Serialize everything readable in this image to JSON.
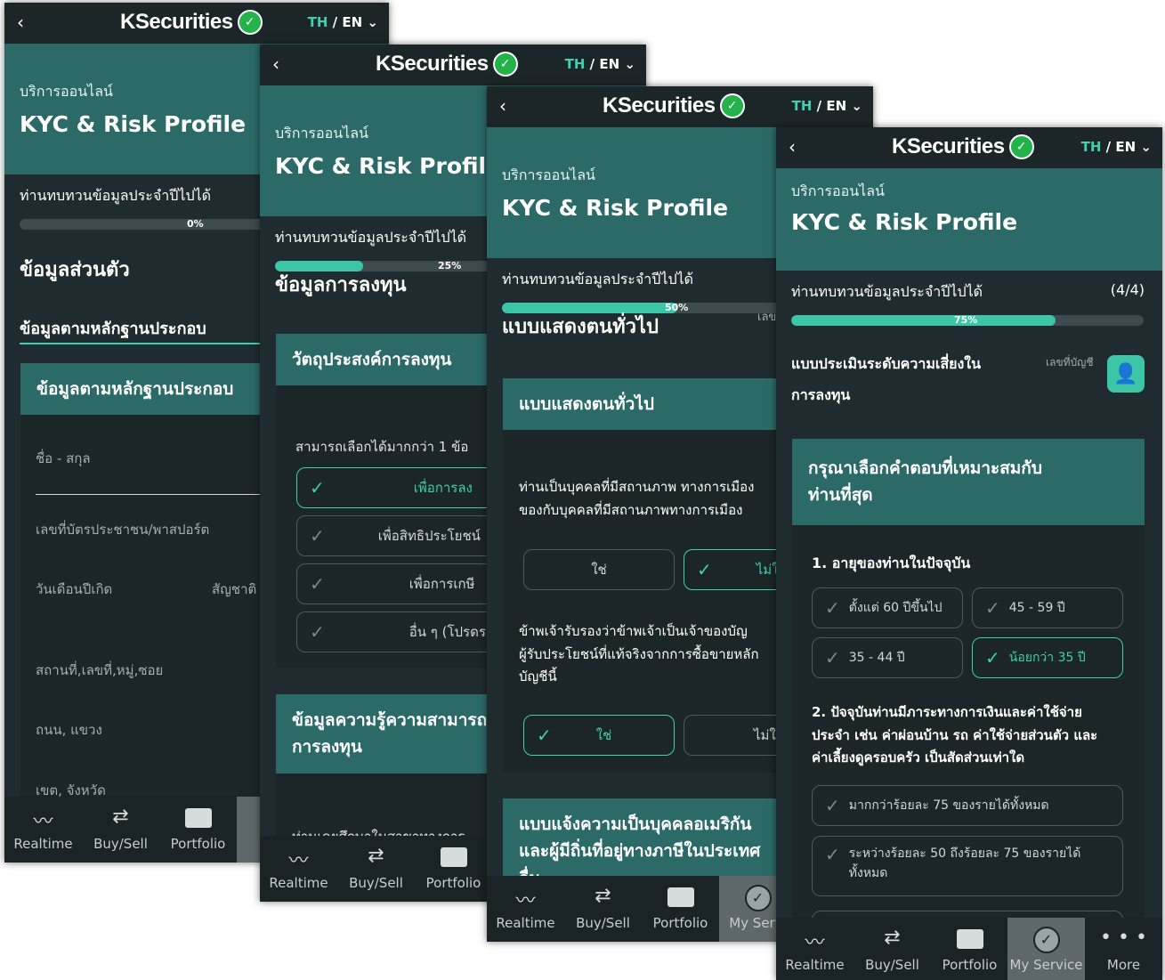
{
  "common": {
    "brand": "KSecurities",
    "lang_th": "TH",
    "lang_sep": " / ",
    "lang_en": "EN",
    "service_subtitle": "บริการออนไลน์",
    "title": "KYC & Risk Profile",
    "progress_label": "ท่านทบทวนข้อมูลประจำปีไปได้",
    "nav": {
      "realtime": "Realtime",
      "buysell": "Buy/Sell",
      "portfolio": "Portfolio",
      "my_service": "My Service",
      "my_service_cut1": "My",
      "my_service_cut3": "My Servi",
      "more": "More"
    }
  },
  "screen1": {
    "progress": "0%",
    "progress_fraction": 0.0,
    "section": "ข้อมูลส่วนตัว",
    "tab": "ข้อมูลตามหลักฐานประกอบ",
    "card_head": "ข้อมูลตามหลักฐานประกอบ",
    "fields": {
      "name": "ชื่อ - สกุล",
      "id_passport": "เลขที่บัตรประชาชน/พาสปอร์ต",
      "birthdate": "วันเดือนปีเกิด",
      "nationality": "สัญชาติ",
      "address": "สถานที่,เลขที่,หมู่,ซอย",
      "road": "ถนน, แขวง",
      "district": "เขต, จังหวัด"
    }
  },
  "screen2": {
    "progress": "25%",
    "progress_fraction": 0.25,
    "section": "ข้อมูลการลงทุน",
    "card_head": "วัตถุประสงค์การลงทุน",
    "hint": "สามารถเลือกได้มากกว่า 1 ข้อ",
    "options": [
      "เพื่อการลง",
      "เพื่อสิทธิประโยชน์",
      "เพื่อการเกษี",
      "อื่น ๆ (โปรดร"
    ],
    "card2_head_l1": "ข้อมูลความรู้ความสามารถ",
    "card2_head_l2": "การลงทุน",
    "cut_text": "ท่านเคยศึกษาในสาขาทางการ"
  },
  "screen3": {
    "progress": "50%",
    "progress_fraction": 0.5,
    "side_label": "เลข",
    "section": "แบบแสดงตนทั่วไป",
    "card_head": "แบบแสดงตนทั่วไป",
    "q1_l1": "ท่านเป็นบุคคลที่มีสถานภาพ ทางการเมือง",
    "q1_l2": "ของกับบุคคลที่มีสถานภาพทางการเมือง",
    "yes": "ใช่",
    "no": "ไม่ใ",
    "q2_l1": "ข้าพเจ้ารับรองว่าข้าพเจ้าเป็นเจ้าของบัญ",
    "q2_l2": "ผู้รับประโยชน์ที่แท้จริงจากการซื้อขายหลัก",
    "q2_l3": "บัญชีนี้",
    "card2_l1": "แบบแจ้งความเป็นบุคคลอเมริกัน",
    "card2_l2": "และผู้มีถิ่นที่อยู่ทางภาษีในประเทศ",
    "card2_l3": "อื่น"
  },
  "screen4": {
    "progress": "75%",
    "progress_fraction": 0.75,
    "count": "(4/4)",
    "section_l1": "แบบประเมินระดับความเสี่ยงใน",
    "section_l2": "การลงทุน",
    "account_label": "เลขที่บัญชี",
    "card_head_l1": "กรุณาเลือกคำตอบที่เหมาะสมกับ",
    "card_head_l2": "ท่านที่สุด",
    "q1": "1. อายุของท่านในปัจจุบัน",
    "q1_options": [
      "ตั้งแต่ 60 ปีขึ้นไป",
      "45 - 59 ปี",
      "35 - 44 ปี",
      "น้อยกว่า 35 ปี"
    ],
    "q2_l1": "2. ปัจจุบันท่านมีภาระทางการเงินและค่าใช้จ่าย",
    "q2_l2": "ประจำ เช่น ค่าผ่อนบ้าน รถ ค่าใช้จ่ายส่วนตัว และ",
    "q2_l3": "ค่าเลี้ยงดูครอบครัว เป็นสัดส่วนเท่าใด",
    "q2_opt1": "มากกว่าร้อยละ 75 ของรายได้ทั้งหมด",
    "q2_opt2_l1": "ระหว่างร้อยละ 50 ถึงร้อยละ 75 ของรายได้",
    "q2_opt2_l2": "ทั้งหมด"
  }
}
